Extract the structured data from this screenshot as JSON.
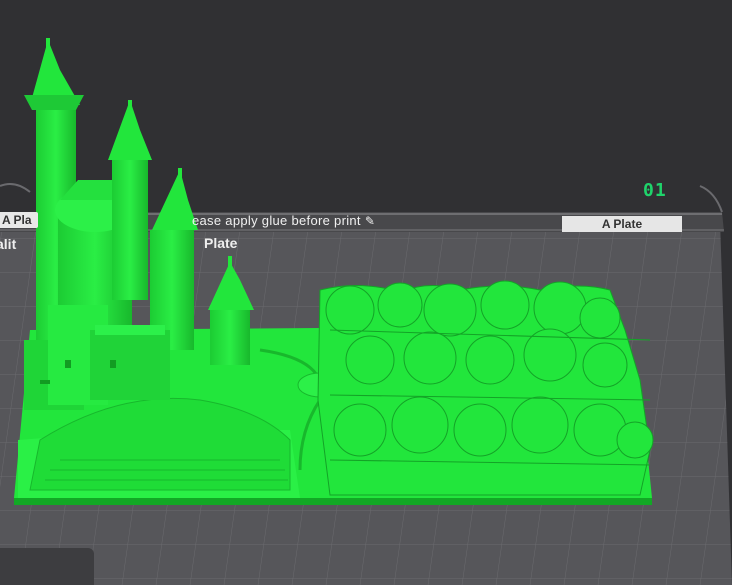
{
  "plate": {
    "number": "01",
    "label_left": "A Pla",
    "label_right": "A Plate",
    "notice": "ease apply glue before print",
    "quality_text": "alit",
    "plate_name": "Plate"
  },
  "colors": {
    "background": "#303033",
    "plate_grid": "#5c5c60",
    "model": "#22e63c",
    "model_shadow": "#15b32a",
    "accent": "#1fd36b"
  },
  "model": {
    "description_icon": "minecraft-castle-model-icon"
  },
  "icons": {
    "edit": "pencil-icon"
  }
}
